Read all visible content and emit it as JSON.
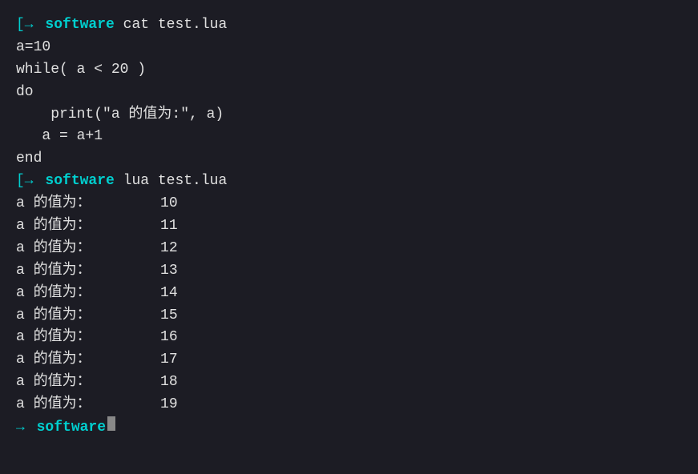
{
  "terminal": {
    "background": "#1c1c24",
    "lines": [
      {
        "type": "prompt",
        "arrow": "[→",
        "software": "software",
        "command": " cat test.lua"
      },
      {
        "type": "code",
        "text": "a=10"
      },
      {
        "type": "code",
        "text": "while( a < 20 )"
      },
      {
        "type": "code",
        "text": "do"
      },
      {
        "type": "code",
        "text": "    print(\"a 的值为:\", a)"
      },
      {
        "type": "code",
        "text": "   a = a+1"
      },
      {
        "type": "code",
        "text": "end"
      },
      {
        "type": "prompt",
        "arrow": "[→",
        "software": "software",
        "command": " lua test.lua"
      },
      {
        "type": "output",
        "label": "a 的值为：",
        "value": "10"
      },
      {
        "type": "output",
        "label": "a 的值为：",
        "value": "11"
      },
      {
        "type": "output",
        "label": "a 的值为：",
        "value": "12"
      },
      {
        "type": "output",
        "label": "a 的值为：",
        "value": "13"
      },
      {
        "type": "output",
        "label": "a 的值为：",
        "value": "14"
      },
      {
        "type": "output",
        "label": "a 的值为：",
        "value": "15"
      },
      {
        "type": "output",
        "label": "a 的值为：",
        "value": "16"
      },
      {
        "type": "output",
        "label": "a 的值为：",
        "value": "17"
      },
      {
        "type": "output",
        "label": "a 的值为：",
        "value": "18"
      },
      {
        "type": "output",
        "label": "a 的值为：",
        "value": "19"
      },
      {
        "type": "prompt-end",
        "arrow": "→",
        "software": "software"
      }
    ],
    "prompt": {
      "arrow_char": "[→",
      "arrow_end_char": "→",
      "software_label": "software"
    }
  }
}
